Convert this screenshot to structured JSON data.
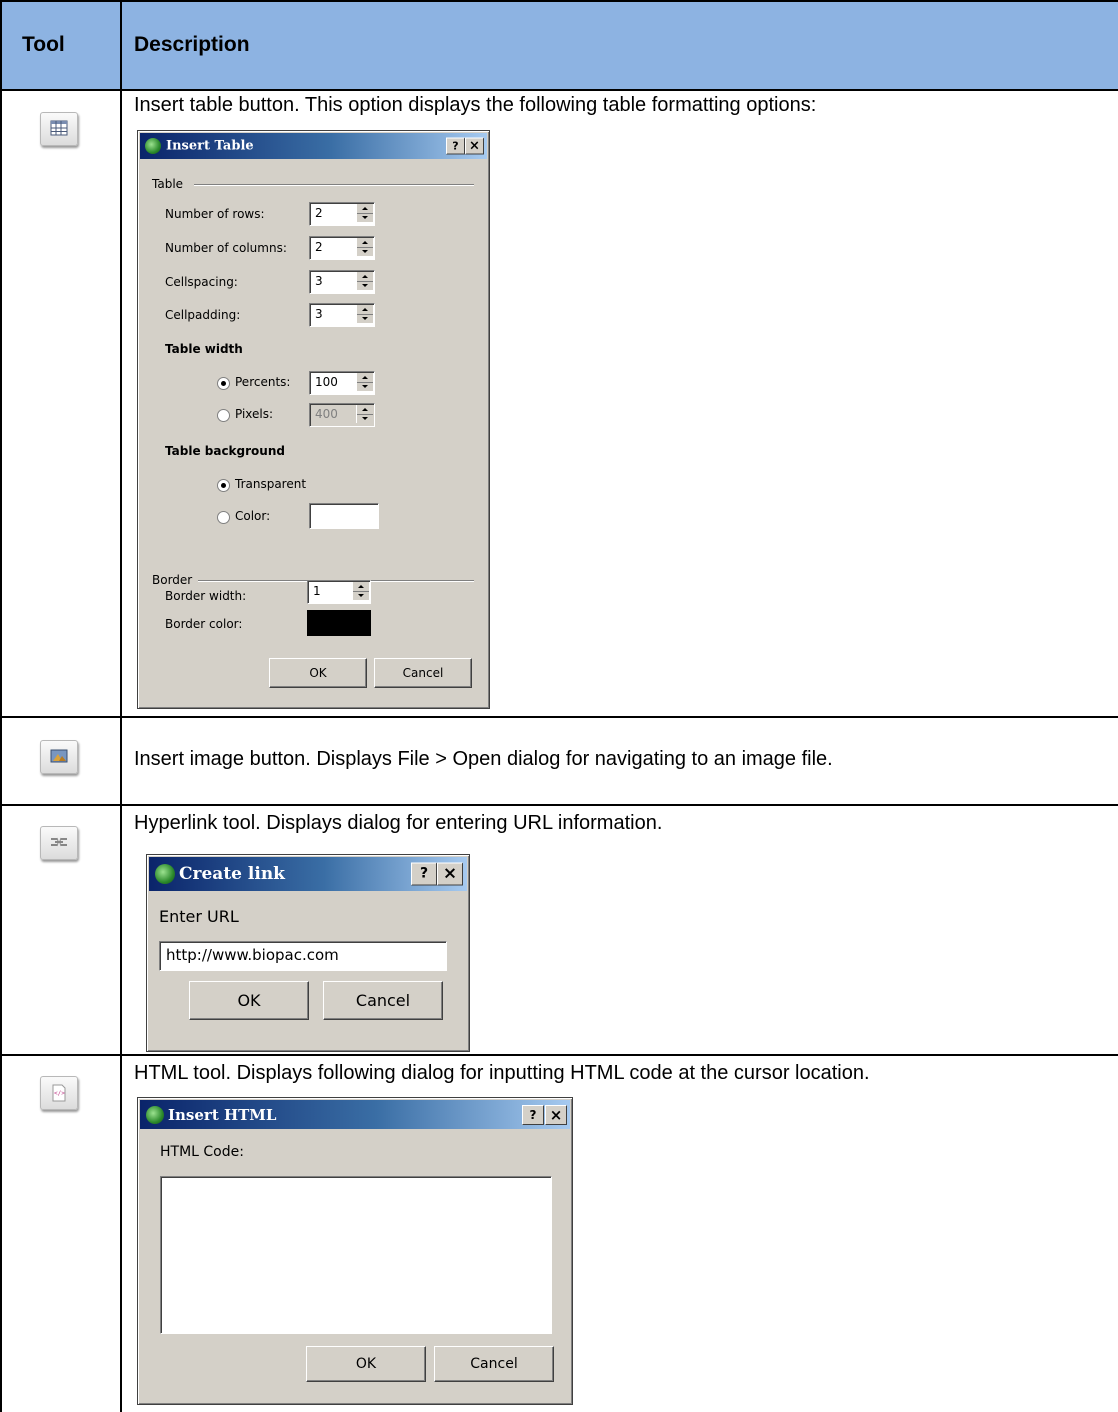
{
  "table": {
    "headers": {
      "tool": "Tool",
      "description": "Description"
    },
    "rows": [
      {
        "icon": "insert-table-icon",
        "description": "Insert table button. This option displays the following table formatting options:"
      },
      {
        "icon": "insert-image-icon",
        "description": "Insert image button. Displays File > Open dialog for navigating to an image file."
      },
      {
        "icon": "hyperlink-icon",
        "description": "Hyperlink tool. Displays dialog for entering URL information."
      },
      {
        "icon": "html-code-icon",
        "description": "HTML tool. Displays following dialog for inputting HTML code at the cursor location."
      }
    ]
  },
  "insert_table_dialog": {
    "title": "Insert Table",
    "help": "?",
    "close": "×",
    "table_group": "Table",
    "rows_label": "Number of rows:",
    "rows_value": "2",
    "cols_label": "Number of columns:",
    "cols_value": "2",
    "spacing_label": "Cellspacing:",
    "spacing_value": "3",
    "padding_label": "Cellpadding:",
    "padding_value": "3",
    "width_heading": "Table width",
    "percents_label": "Percents:",
    "percents_value": "100",
    "pixels_label": "Pixels:",
    "pixels_value": "400",
    "bg_heading": "Table background",
    "transparent_label": "Transparent",
    "color_label": "Color:",
    "color_value": "#ffffff",
    "border_group": "Border",
    "border_width_label": "Border width:",
    "border_width_value": "1",
    "border_color_label": "Border color:",
    "border_color_value": "#000000",
    "ok": "OK",
    "cancel": "Cancel"
  },
  "create_link_dialog": {
    "title": "Create link",
    "help": "?",
    "close": "×",
    "url_label": "Enter URL",
    "url_value": "http://www.biopac.com",
    "ok": "OK",
    "cancel": "Cancel"
  },
  "insert_html_dialog": {
    "title": "Insert HTML",
    "help": "?",
    "close": "×",
    "code_label": "HTML Code:",
    "code_value": "",
    "ok": "OK",
    "cancel": "Cancel"
  },
  "colors": {
    "header_bg": "#8db3e2",
    "dialog_bg": "#d4d0c8",
    "titlebar_start": "#0a246a",
    "titlebar_end": "#a6caf0"
  }
}
